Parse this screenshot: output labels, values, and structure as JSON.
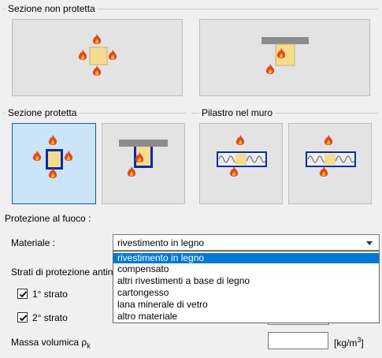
{
  "groups": {
    "unprotected": "Sezione non protetta",
    "protected": "Sezione protetta",
    "wall": "Pilastro nel muro"
  },
  "fire_protection": {
    "heading": "Protezione al fuoco :",
    "material_label": "Materiale :",
    "material_value": "rivestimento in legno",
    "options": [
      "rivestimento in legno",
      "compensato",
      "altri rivestimenti a base di legno",
      "cartongesso",
      "lana minerale di vetro",
      "altro materiale"
    ],
    "layers_label": "Strati di protezione antin",
    "layer1_label": "1° strato",
    "layer2_label": "2° strato",
    "density_label": "Massa volumica ρ",
    "density_sub": "k",
    "density_unit": "[kg/m",
    "density_unit_sup": "3",
    "density_unit_close": "]"
  },
  "colors": {
    "accent": "#0078d7",
    "selected_tile": "#cce4f7",
    "section_fill": "#f4dc8f",
    "flame": "#e0481c"
  }
}
